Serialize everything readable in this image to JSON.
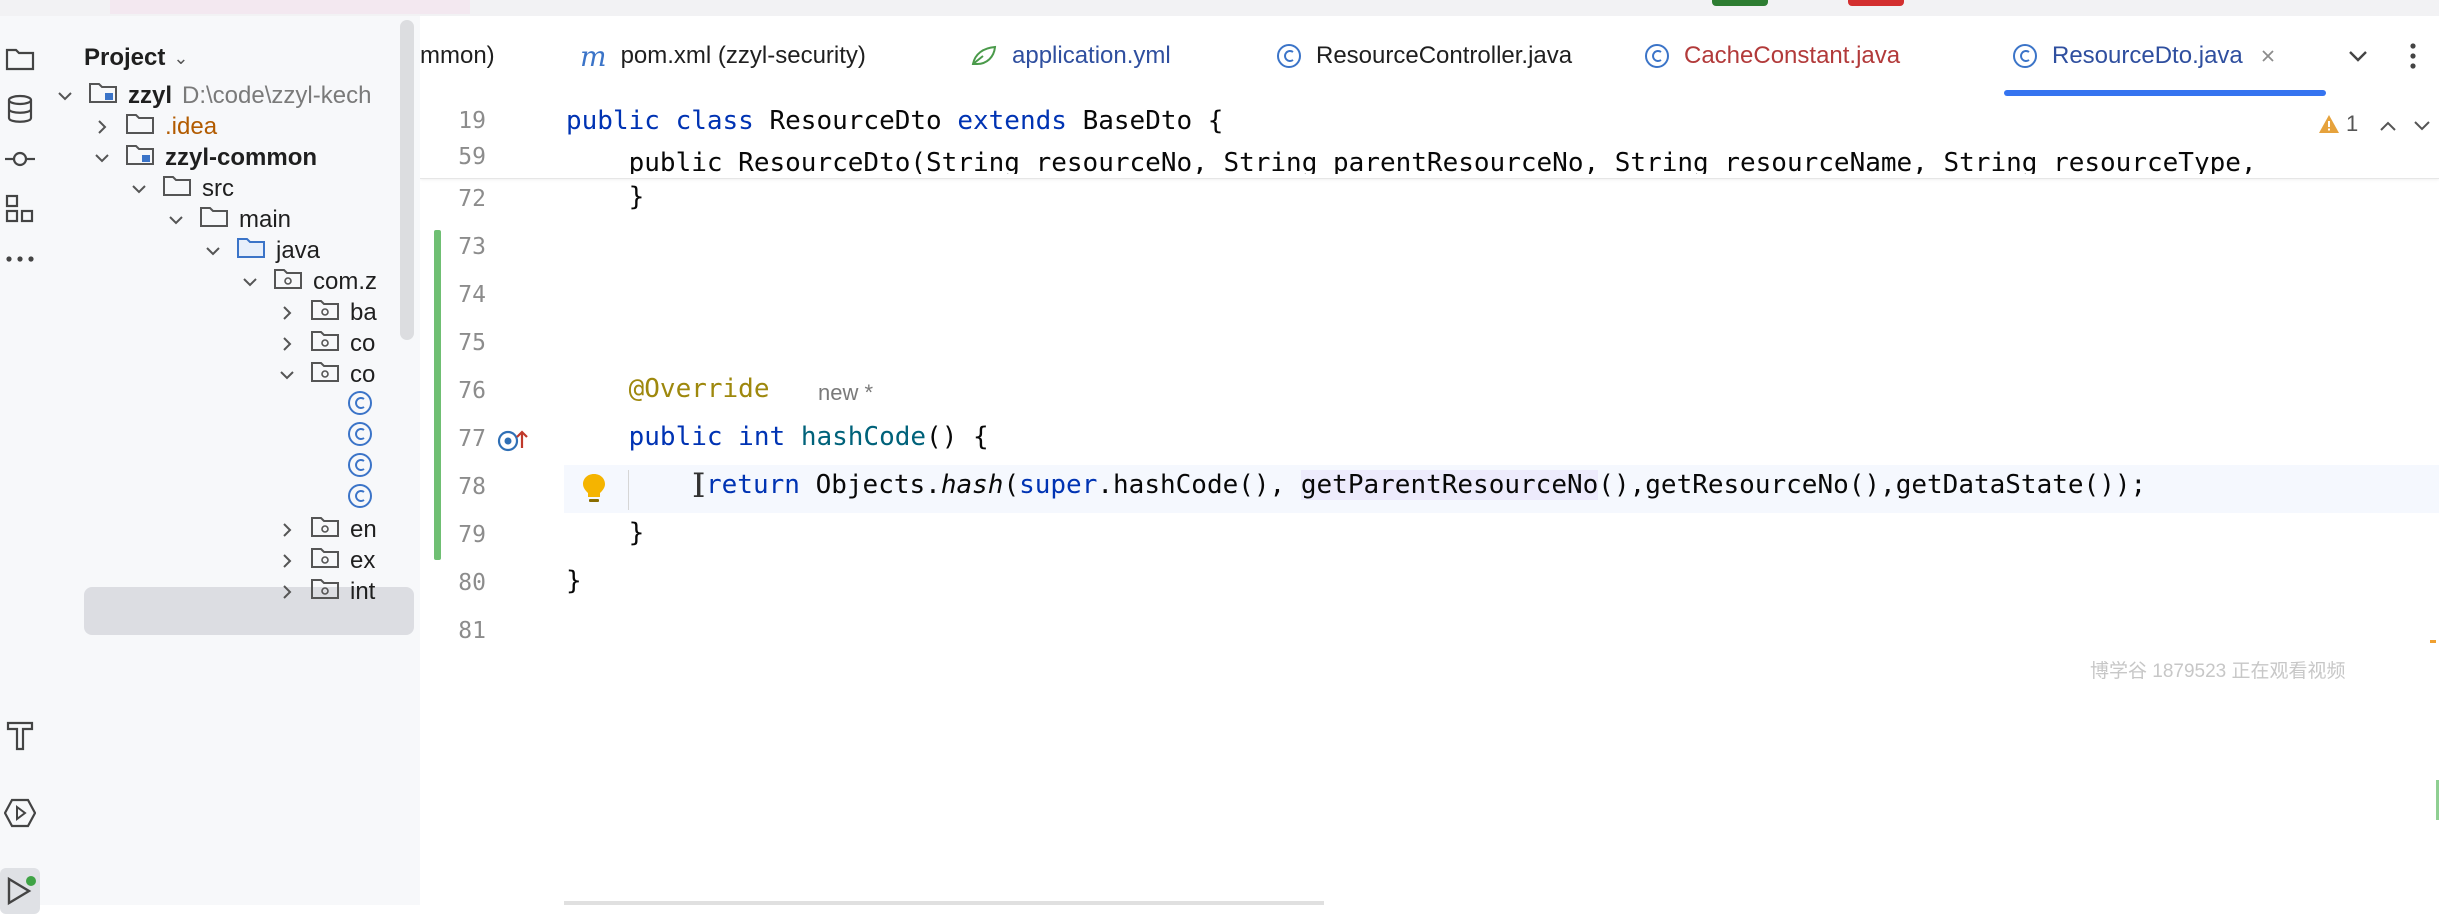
{
  "colors": {
    "accent": "#3574f0",
    "vcs_added": "#6fbf73",
    "keyword": "#0033b3",
    "method": "#00627a",
    "annotation": "#9e880d",
    "warning": "#e6a23c"
  },
  "toolstrip": {
    "tools": [
      {
        "name": "project-folder-icon",
        "active": false
      },
      {
        "name": "database-icon",
        "active": false
      },
      {
        "name": "commit-icon",
        "active": false
      },
      {
        "name": "structure-icon",
        "active": false
      },
      {
        "name": "more-icon",
        "active": false
      },
      {
        "name": "build-hammer-icon",
        "active": false
      },
      {
        "name": "services-icon",
        "active": false
      },
      {
        "name": "run-icon",
        "active": true
      }
    ]
  },
  "project": {
    "title": "Project",
    "tree": [
      {
        "label": "zzyl",
        "extra": "D:\\code\\zzyl-kech",
        "arrow": "v",
        "icon": "module",
        "bold": true,
        "color": "normal",
        "depth": 0
      },
      {
        "label": ".idea",
        "arrow": ">",
        "icon": "folder",
        "bold": false,
        "color": "orange",
        "depth": 1
      },
      {
        "label": "zzyl-common",
        "arrow": "v",
        "icon": "module",
        "bold": true,
        "color": "normal",
        "depth": 1
      },
      {
        "label": "src",
        "arrow": "v",
        "icon": "folder",
        "bold": false,
        "color": "normal",
        "depth": 2
      },
      {
        "label": "main",
        "arrow": "v",
        "icon": "folder",
        "bold": false,
        "color": "normal",
        "depth": 3
      },
      {
        "label": "java",
        "arrow": "v",
        "icon": "folder-blue",
        "bold": false,
        "color": "normal",
        "depth": 4
      },
      {
        "label": "com.z",
        "arrow": "v",
        "icon": "package",
        "bold": false,
        "color": "normal",
        "depth": 5
      },
      {
        "label": "ba",
        "arrow": ">",
        "icon": "package",
        "bold": false,
        "color": "normal",
        "depth": 6
      },
      {
        "label": "co",
        "arrow": ">",
        "icon": "package",
        "bold": false,
        "color": "normal",
        "depth": 6
      },
      {
        "label": "co",
        "arrow": "v",
        "icon": "package",
        "bold": false,
        "color": "normal",
        "depth": 6
      },
      {
        "label": "",
        "arrow": "",
        "icon": "class",
        "bold": false,
        "color": "normal",
        "depth": 7
      },
      {
        "label": "",
        "arrow": "",
        "icon": "class",
        "bold": false,
        "color": "normal",
        "depth": 7
      },
      {
        "label": "",
        "arrow": "",
        "icon": "class",
        "bold": false,
        "color": "normal",
        "depth": 7
      },
      {
        "label": "",
        "arrow": "",
        "icon": "class",
        "bold": false,
        "color": "normal",
        "depth": 7
      },
      {
        "label": "en",
        "arrow": ">",
        "icon": "package",
        "bold": false,
        "color": "normal",
        "depth": 6
      },
      {
        "label": "ex",
        "arrow": ">",
        "icon": "package",
        "bold": false,
        "color": "normal",
        "depth": 6
      },
      {
        "label": "int",
        "arrow": ">",
        "icon": "package",
        "bold": false,
        "color": "normal",
        "depth": 6
      }
    ]
  },
  "tabs": [
    {
      "label": "mmon)",
      "icon": "none",
      "color": "#1f1f1f",
      "active": false
    },
    {
      "label": "pom.xml (zzyl-security)",
      "icon": "maven",
      "color": "#1f1f1f",
      "active": false
    },
    {
      "label": "application.yml",
      "icon": "spring",
      "color": "#2f4f9f",
      "active": false
    },
    {
      "label": "ResourceController.java",
      "icon": "class",
      "color": "#1f1f1f",
      "active": false
    },
    {
      "label": "CacheConstant.java",
      "icon": "class",
      "color": "#b23a3a",
      "active": false
    },
    {
      "label": "ResourceDto.java",
      "icon": "class",
      "color": "#2f4f9f",
      "active": true
    }
  ],
  "editor": {
    "sticky": [
      {
        "ln": "19"
      },
      {
        "ln": "59"
      }
    ],
    "lines": [
      {
        "ln": "72"
      },
      {
        "ln": "73"
      },
      {
        "ln": "74"
      },
      {
        "ln": "75"
      },
      {
        "ln": "76"
      },
      {
        "ln": "77"
      },
      {
        "ln": "78"
      },
      {
        "ln": "79"
      },
      {
        "ln": "80"
      },
      {
        "ln": "81"
      }
    ],
    "code": {
      "l19_a": "public class ",
      "l19_b": "ResourceDto ",
      "l19_c": "extends ",
      "l19_d": "BaseDto {",
      "l59": "    public ResourceDto(String resourceNo, String parentResourceNo, String resourceName, String resourceType,",
      "l72": "    }",
      "l76": "    @Override",
      "l77_a": "    public int ",
      "l77_b": "hashCode",
      "l77_c": "() {",
      "l78_a": "return ",
      "l78_b": "Objects.",
      "l78_c": "hash",
      "l78_d": "(",
      "l78_e": "super",
      ".": ".",
      "l78_f": ".hashCode(), ",
      "l78_g": "getParentResourceNo",
      "l78_h": "(),getResourceNo(),getDataState());",
      "l79": "    }",
      "l80": "}"
    },
    "inlay_hint": "new *",
    "warning_count": "1",
    "watermark": "博学谷 1879523 正在观看视频"
  }
}
